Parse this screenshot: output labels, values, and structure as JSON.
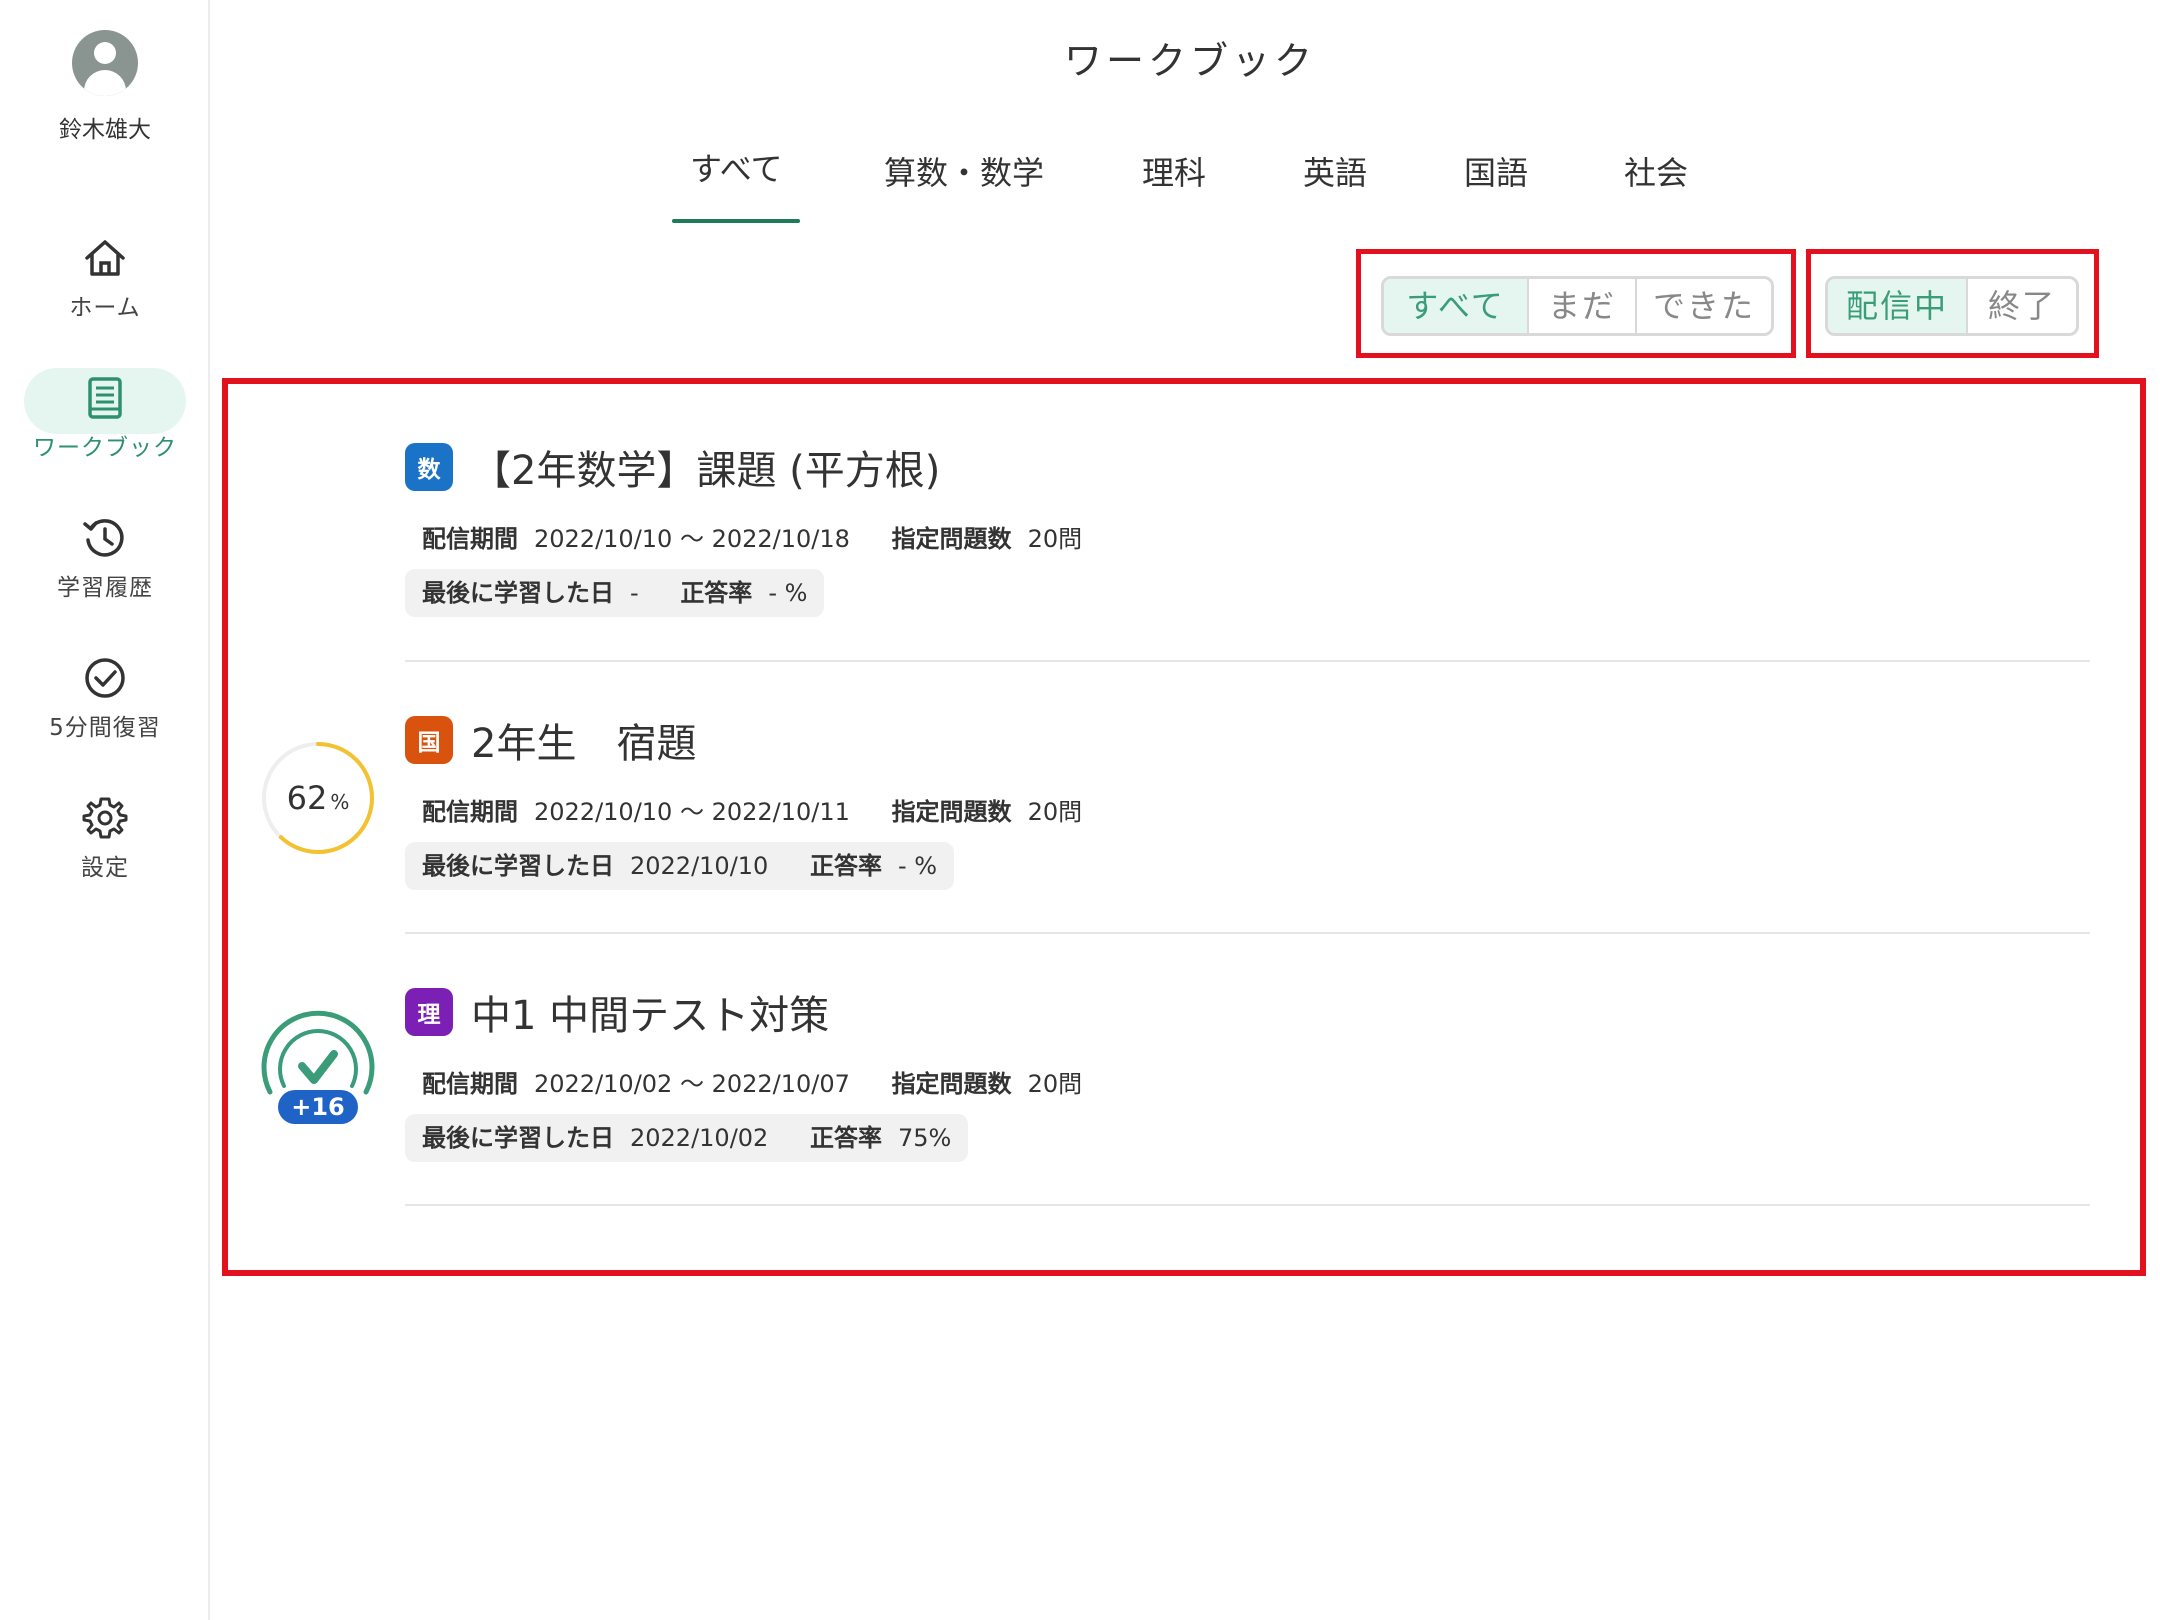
{
  "user": {
    "name": "鈴木雄大"
  },
  "sidebar": {
    "items": [
      {
        "label": "ホーム",
        "icon": "home-icon"
      },
      {
        "label": "ワークブック",
        "icon": "book-icon",
        "active": true
      },
      {
        "label": "学習履歴",
        "icon": "history-icon"
      },
      {
        "label": "5分間復習",
        "icon": "check-circle-icon"
      },
      {
        "label": "設定",
        "icon": "gear-icon"
      }
    ]
  },
  "header": {
    "title": "ワークブック"
  },
  "tabs": [
    {
      "label": "すべて",
      "active": true
    },
    {
      "label": "算数・数学"
    },
    {
      "label": "理科"
    },
    {
      "label": "英語"
    },
    {
      "label": "国語"
    },
    {
      "label": "社会"
    }
  ],
  "filters": {
    "status": {
      "options": [
        "すべて",
        "まだ",
        "できた"
      ],
      "selected": "すべて"
    },
    "delivery": {
      "options": [
        "配信中",
        "終了"
      ],
      "selected": "配信中"
    }
  },
  "labels": {
    "period": "配信期間",
    "question_count": "指定問題数",
    "last_studied": "最後に学習した日",
    "accuracy": "正答率"
  },
  "workbooks": [
    {
      "subject_badge": "数",
      "badge_color": "#1a73c7",
      "title": "【2年数学】課題 (平方根)",
      "period": "2022/10/10 〜 2022/10/18",
      "question_count": "20問",
      "last_studied": "-",
      "accuracy": "- %",
      "progress": null
    },
    {
      "subject_badge": "国",
      "badge_color": "#d9530f",
      "title": "2年生　宿題",
      "period": "2022/10/10 〜 2022/10/11",
      "question_count": "20問",
      "last_studied": "2022/10/10",
      "accuracy": "- %",
      "progress": {
        "value": "62",
        "unit": "%",
        "fraction": 0.62,
        "color": "#f2c230"
      }
    },
    {
      "subject_badge": "理",
      "badge_color": "#7b1fb5",
      "title": "中1 中間テスト対策",
      "period": "2022/10/02 〜 2022/10/07",
      "question_count": "20問",
      "last_studied": "2022/10/02",
      "accuracy": "75%",
      "completed": {
        "bonus": "+16",
        "color": "#3a9c79",
        "badge_color": "#1f63c7"
      }
    }
  ],
  "colors": {
    "accent": "#3a9c79",
    "accent_bg": "#e4f6ef",
    "highlight_box": "#e3101e"
  }
}
